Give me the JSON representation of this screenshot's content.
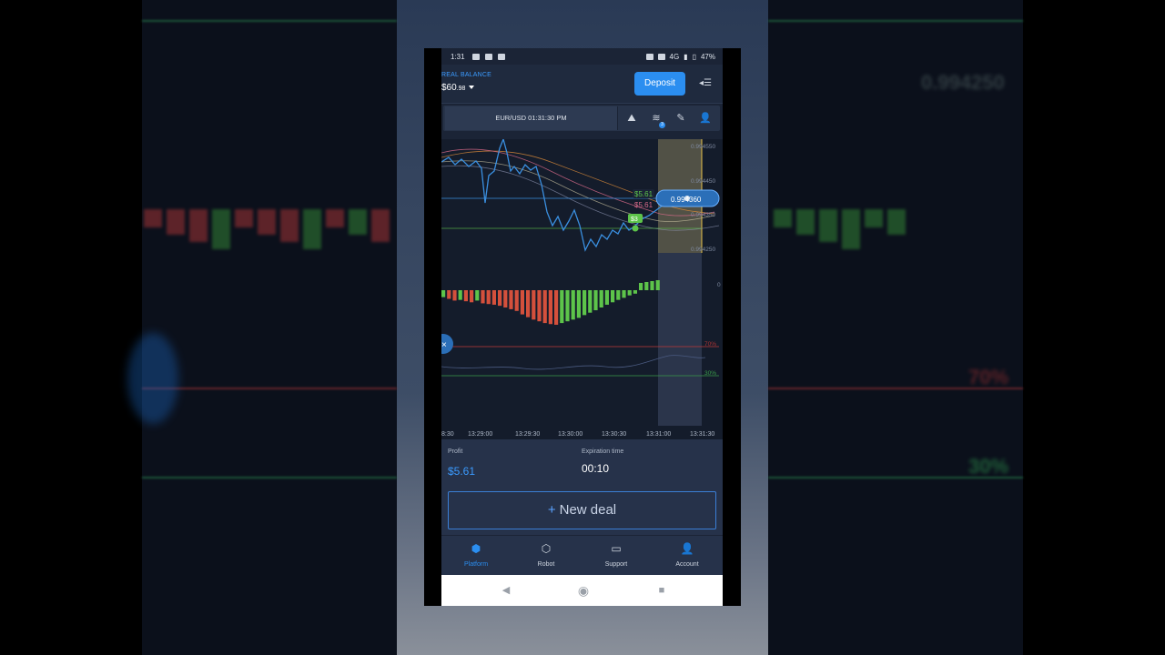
{
  "status_bar": {
    "time": "1:31",
    "network": "4G",
    "battery": "47%"
  },
  "account": {
    "balance_label": "REAL BALANCE",
    "balance_main": "$60",
    "balance_cents": ".98"
  },
  "header": {
    "deposit_label": "Deposit"
  },
  "toolbar": {
    "pair_time": "EUR/USD 01:31:30 PM",
    "indicator_badge": "3"
  },
  "chart": {
    "price_labels": [
      "0.994550",
      "0.994450",
      "0.994350",
      "0.994250"
    ],
    "current_price": "0.994360",
    "trade_profit_green": "$5.61",
    "trade_profit_red": "$5.61",
    "trade_tag": "$3",
    "oscillator_zero": "0",
    "rsi_levels": [
      "70%",
      "30%"
    ],
    "time_ticks": [
      "8:30",
      "13:29:00",
      "13:29:30",
      "13:30:00",
      "13:30:30",
      "13:31:00",
      "13:31:30"
    ],
    "colors": {
      "price_line": "#3a8fe0",
      "bull": "#5dc44a",
      "bear": "#d4503c",
      "highlight": "#e8c24a"
    },
    "histogram": [
      -0.2,
      -0.25,
      -0.3,
      -0.28,
      -0.32,
      -0.35,
      -0.3,
      -0.38,
      -0.4,
      -0.42,
      -0.45,
      -0.5,
      -0.55,
      -0.6,
      -0.7,
      -0.78,
      -0.85,
      -0.9,
      -0.95,
      -0.98,
      -1.0,
      -0.95,
      -0.9,
      -0.85,
      -0.8,
      -0.72,
      -0.65,
      -0.58,
      -0.5,
      -0.42,
      -0.35,
      -0.28,
      -0.22,
      -0.15,
      -0.1
    ]
  },
  "deal_panel": {
    "profit_label": "Profit",
    "profit_value": "$5.61",
    "expiration_label": "Expiration time",
    "expiration_value": "00:10",
    "new_deal_label": "New deal"
  },
  "nav": {
    "items": [
      {
        "label": "Platform",
        "icon": "platform-icon"
      },
      {
        "label": "Robot",
        "icon": "robot-icon"
      },
      {
        "label": "Support",
        "icon": "chat-icon"
      },
      {
        "label": "Account",
        "icon": "user-icon"
      }
    ]
  },
  "backdrop": {
    "price_right": "0.994250",
    "rsi_70": "70%",
    "rsi_30": "30%"
  }
}
